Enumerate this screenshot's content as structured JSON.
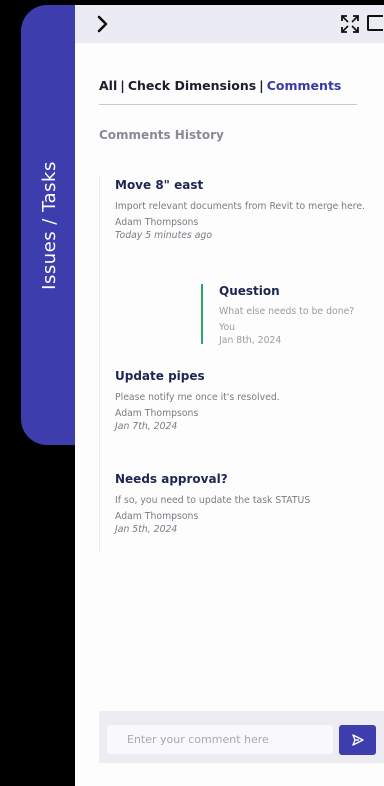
{
  "side_tab": {
    "label": "Issues / Tasks"
  },
  "topbar": {
    "back_icon": "chevron-right-icon",
    "expand_icon": "expand-icon",
    "window_icon": "window-icon"
  },
  "filter": {
    "all": "All",
    "sep1": "|",
    "check_dimensions": "Check Dimensions",
    "sep2": "|",
    "comments": "Comments",
    "active": "Comments"
  },
  "history": {
    "title": "Comments History"
  },
  "comments": [
    {
      "title": "Move 8\" east",
      "body": "Import relevant documents from Revit to merge here.",
      "author": "Adam Thompsons",
      "date": "Today 5 minutes ago"
    },
    {
      "title": "Update pipes",
      "body": "Please notify me once it's resolved.",
      "author": "Adam Thompsons",
      "date": "Jan 7th, 2024"
    },
    {
      "title": "Needs approval?",
      "body": "If so, you need to update the task STATUS",
      "author": "Adam Thompsons",
      "date": "Jan 5th, 2024"
    }
  ],
  "reply": {
    "title": "Question",
    "body": "What else needs to be done?",
    "author": "You",
    "date": "Jan 8th, 2024"
  },
  "composer": {
    "placeholder": "Enter your comment here",
    "send_icon": "send-icon"
  },
  "colors": {
    "accent": "#3d3dad",
    "reply_line": "#2aa66a",
    "title": "#1f2553"
  }
}
